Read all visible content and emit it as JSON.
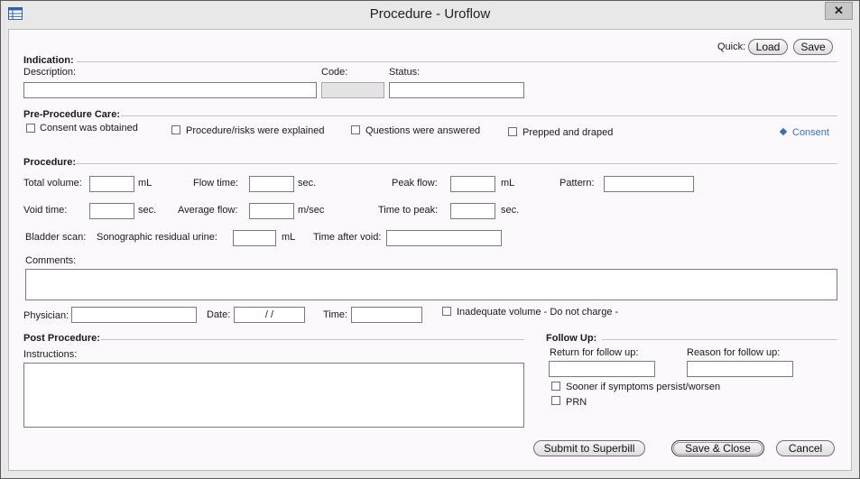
{
  "window": {
    "title": "Procedure - Uroflow",
    "close_glyph": "✕",
    "app_icon": "table-window-icon"
  },
  "quick": {
    "label": "Quick:",
    "load_label": "Load",
    "save_label": "Save"
  },
  "indication": {
    "heading": "Indication:",
    "description_label": "Description:",
    "code_label": "Code:",
    "status_label": "Status:",
    "description_value": "",
    "code_value": "",
    "status_value": ""
  },
  "pre_care": {
    "heading": "Pre-Procedure Care:",
    "consent_obtained": "Consent was obtained",
    "risks_explained": "Procedure/risks were explained",
    "questions_answered": "Questions were answered",
    "prepped_draped": "Prepped and draped",
    "consent_link": "Consent",
    "consent_link_icon": "diamond-bullet-icon"
  },
  "procedure": {
    "heading": "Procedure:",
    "total_volume_label": "Total volume:",
    "total_volume_unit": "mL",
    "flow_time_label": "Flow time:",
    "flow_time_unit": "sec.",
    "peak_flow_label": "Peak flow:",
    "peak_flow_unit": "mL",
    "pattern_label": "Pattern:",
    "void_time_label": "Void time:",
    "void_time_unit": "sec.",
    "average_flow_label": "Average flow:",
    "average_flow_unit": "m/sec",
    "time_to_peak_label": "Time to peak:",
    "time_to_peak_unit": "sec.",
    "bladder_scan_label": "Bladder scan:",
    "residual_label": "Sonographic residual urine:",
    "residual_unit": "mL",
    "time_after_void_label": "Time after void:",
    "comments_label": "Comments:",
    "physician_label": "Physician:",
    "date_label": "Date:",
    "date_value": "/   /",
    "time_label": "Time:",
    "inadequate_label": "Inadequate volume - Do not charge -"
  },
  "post": {
    "heading": "Post Procedure:",
    "instructions_label": "Instructions:"
  },
  "follow_up": {
    "heading": "Follow Up:",
    "return_label": "Return for follow up:",
    "reason_label": "Reason for follow up:",
    "sooner_label": "Sooner if symptoms persist/worsen",
    "prn_label": "PRN"
  },
  "buttons": {
    "submit_label": "Submit to Superbill",
    "save_close_label": "Save & Close",
    "cancel_label": "Cancel"
  }
}
